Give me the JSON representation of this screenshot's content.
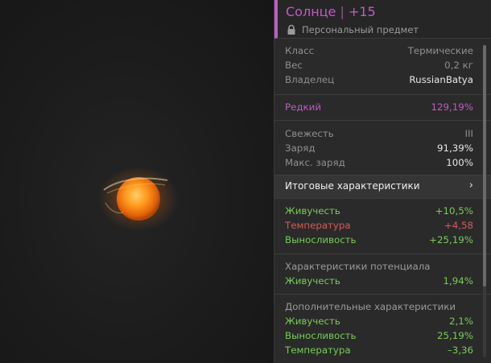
{
  "item": {
    "name": "Солнце",
    "upgrade": "+15",
    "subtitle": "Персональный предмет"
  },
  "info": [
    {
      "label": "Класс",
      "value": "Термические"
    },
    {
      "label": "Вес",
      "value": "0,2 кг"
    },
    {
      "label": "Владелец",
      "value": "RussianBatya"
    }
  ],
  "rarity": {
    "label": "Редкий",
    "value": "129,19%"
  },
  "condition": [
    {
      "label": "Свежесть",
      "value": "III"
    },
    {
      "label": "Заряд",
      "value": "91,39%"
    },
    {
      "label": "Макс. заряд",
      "value": "100%"
    }
  ],
  "final_stats_button": {
    "label": "Итоговые характеристики"
  },
  "final_stats": [
    {
      "label": "Живучесть",
      "value": "+10,5%",
      "color": "#77cc55"
    },
    {
      "label": "Температура",
      "value": "+4,58",
      "color": "#d65a5a"
    },
    {
      "label": "Выносливость",
      "value": "+25,19%",
      "color": "#77cc55"
    }
  ],
  "potential": {
    "heading": "Характеристики потенциала",
    "stats": [
      {
        "label": "Живучесть",
        "value": "1,94%"
      }
    ]
  },
  "extra": {
    "heading": "Дополнительные характеристики",
    "stats": [
      {
        "label": "Живучесть",
        "value": "2,1%"
      },
      {
        "label": "Выносливость",
        "value": "25,19%"
      },
      {
        "label": "Температура",
        "value": "–3,36"
      }
    ]
  },
  "icons": {
    "lock": "lock-icon",
    "chevron": "chevron-right-icon",
    "artifact": "sun-artifact"
  },
  "colors": {
    "rarity_accent": "#c15bc6",
    "positive": "#77cc55",
    "negative": "#d65a5a",
    "artifact_glow": "#ff9a1e"
  }
}
